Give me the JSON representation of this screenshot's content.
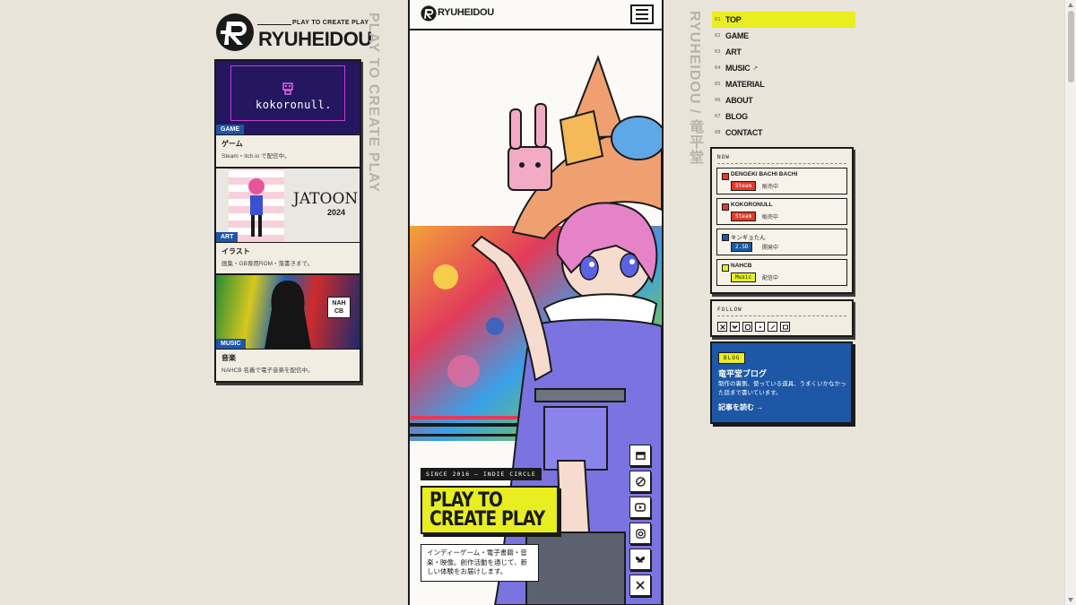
{
  "brand": {
    "name": "RYUHEIDOU",
    "tagline": "PLAY TO CREATE PLAY",
    "vertical_left": "PLAY TO CREATE PLAY",
    "vertical_right": "RYUHEIDOU / 竜平堂"
  },
  "cards": [
    {
      "badge": "GAME",
      "title": "ゲーム",
      "desc": "Steam・itch.io で配信中。",
      "thumb_text": "kokoronull."
    },
    {
      "badge": "ART",
      "title": "イラスト",
      "desc": "画集・GB専用ROM・落書きまで。",
      "thumb_text": "JATOON",
      "thumb_sub": "2024"
    },
    {
      "badge": "MUSIC",
      "title": "音楽",
      "desc": "NAHCB 名義で電子音楽を配信中。",
      "thumb_text": "NAHCB"
    }
  ],
  "hero": {
    "since": "SINCE 2016 — INDIE CIRCLE",
    "headline_1": "PLAY TO",
    "headline_2": "CREATE PLAY",
    "intro": "インディーゲーム・電子書籍・音楽・映像。創作活動を通じて、新しい体験をお届けします。"
  },
  "nav": [
    {
      "num": "01",
      "label": "TOP",
      "active": true
    },
    {
      "num": "02",
      "label": "GAME"
    },
    {
      "num": "03",
      "label": "ART"
    },
    {
      "num": "04",
      "label": "MUSIC",
      "ext": "↗"
    },
    {
      "num": "05",
      "label": "MATERIAL"
    },
    {
      "num": "06",
      "label": "ABOUT"
    },
    {
      "num": "07",
      "label": "BLOG"
    },
    {
      "num": "08",
      "label": "CONTACT"
    }
  ],
  "now": {
    "heading": "NOW",
    "items": [
      {
        "name": "DENGEKI BACHI BACHI",
        "platform": "Steam",
        "status": "販売中",
        "color": "#e03c2c"
      },
      {
        "name": "KOKORONULL",
        "platform": "Steam",
        "status": "販売中",
        "color": "#e03c2c"
      },
      {
        "name": "キンギョたん",
        "platform": "2.5D",
        "status": "開発中",
        "color": "#1d57a6"
      },
      {
        "name": "NAHCB",
        "platform": "Music",
        "status": "配信中",
        "color": "#e8ee20"
      }
    ]
  },
  "follow": {
    "heading": "FOLLOW"
  },
  "blog": {
    "tag": "BLOG",
    "title": "竜平堂ブログ",
    "desc": "制作の裏側、使っている道具、うまくいかなかった話まで書いています。",
    "link": "記事を読む →"
  },
  "colors": {
    "accent_yellow": "#e8ee20",
    "accent_blue": "#1d57a6",
    "accent_red": "#e03c2c",
    "bg": "#e9e4da"
  },
  "icons": [
    "store-icon",
    "pixiv-icon",
    "youtube-icon",
    "instagram-icon",
    "bluesky-icon",
    "x-icon"
  ]
}
